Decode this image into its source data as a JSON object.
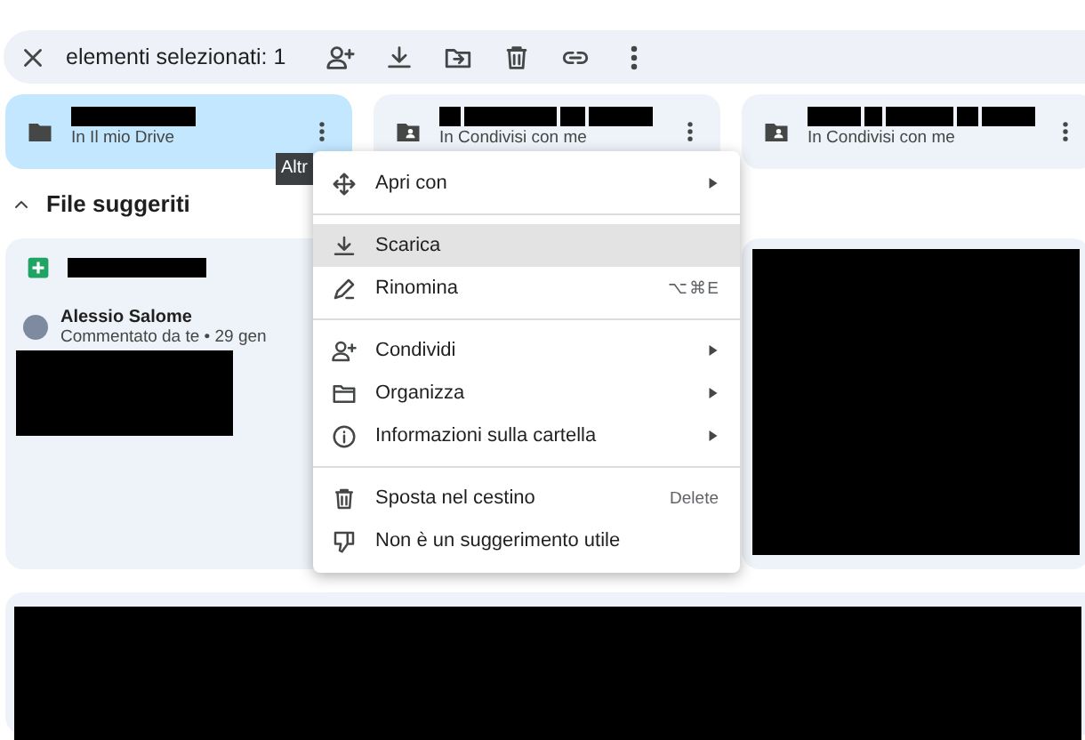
{
  "toolbar": {
    "selection_label": "elementi selezionati: 1",
    "actions": [
      {
        "kind": "share"
      },
      {
        "kind": "download"
      },
      {
        "kind": "move"
      },
      {
        "kind": "trash"
      },
      {
        "kind": "link"
      },
      {
        "kind": "more"
      }
    ]
  },
  "folders": [
    {
      "kind": "own",
      "subtitle": "In Il mio Drive",
      "selected": true
    },
    {
      "kind": "shared",
      "subtitle": "In Condivisi con me",
      "selected": false
    },
    {
      "kind": "shared",
      "subtitle": "In Condivisi con me",
      "selected": false
    }
  ],
  "tooltip": "Altr",
  "section": {
    "title": "File suggeriti",
    "expanded": true
  },
  "suggested": [
    {
      "author": "Alessio Salome",
      "meta": "Commentato da te • 29 gen"
    }
  ],
  "menu": [
    {
      "kind": "item",
      "label": "Apri con",
      "submenu": true,
      "highlighted": false
    },
    {
      "kind": "divider"
    },
    {
      "kind": "item",
      "label": "Scarica",
      "submenu": false,
      "highlighted": true
    },
    {
      "kind": "item",
      "label": "Rinomina",
      "shortcut": "⌥⌘E",
      "submenu": false,
      "highlighted": false
    },
    {
      "kind": "divider"
    },
    {
      "kind": "item",
      "label": "Condividi",
      "submenu": true,
      "highlighted": false
    },
    {
      "kind": "item",
      "label": "Organizza",
      "submenu": true,
      "highlighted": false
    },
    {
      "kind": "item",
      "label": "Informazioni sulla cartella",
      "submenu": true,
      "highlighted": false
    },
    {
      "kind": "divider"
    },
    {
      "kind": "item",
      "label": "Sposta nel cestino",
      "shortcut": "Delete",
      "submenu": false,
      "highlighted": false
    },
    {
      "kind": "item",
      "label": "Non è un suggerimento utile",
      "submenu": false,
      "highlighted": false
    }
  ]
}
